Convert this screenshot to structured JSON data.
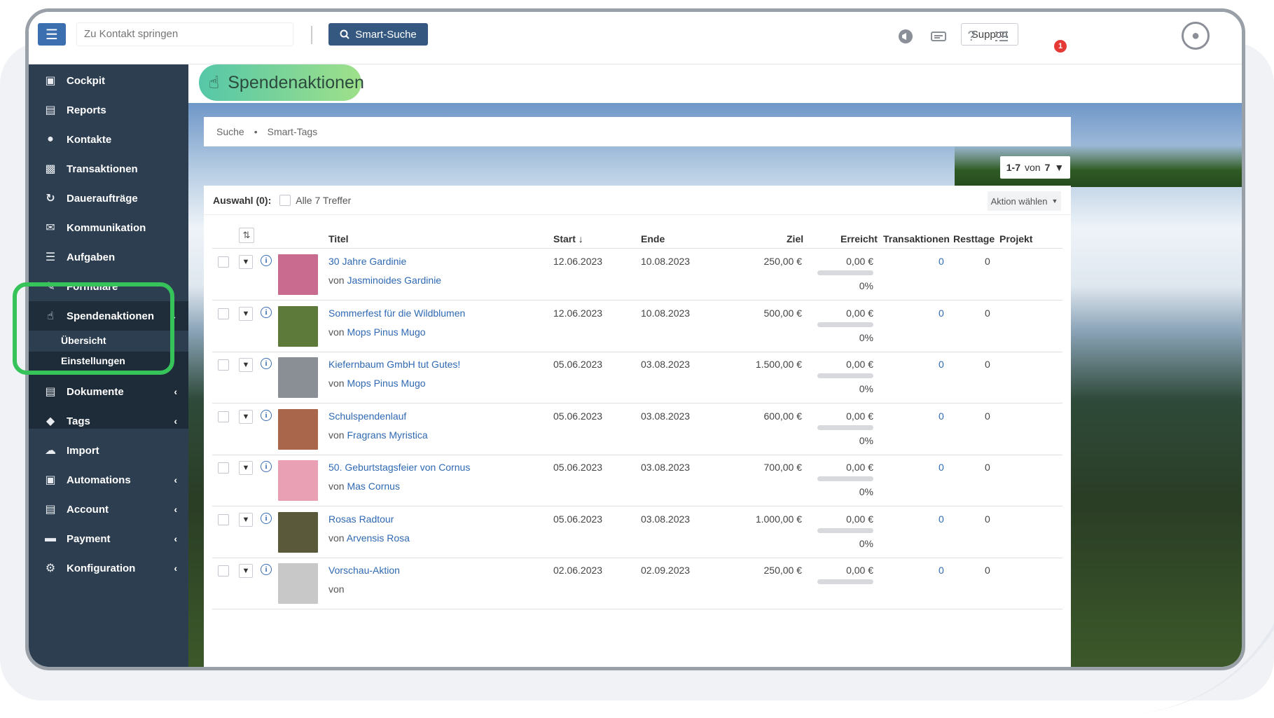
{
  "topbar": {
    "jump_placeholder": "Zu Kontakt springen",
    "smart_search_label": "Smart-Suche",
    "support_label": "Support",
    "notification_count": "1"
  },
  "sidebar": {
    "items": [
      {
        "label": "Cockpit",
        "icon": "laptop-icon"
      },
      {
        "label": "Reports",
        "icon": "chart-icon"
      },
      {
        "label": "Kontakte",
        "icon": "users-icon"
      },
      {
        "label": "Transaktionen",
        "icon": "money-icon"
      },
      {
        "label": "Daueraufträge",
        "icon": "recurring-icon"
      },
      {
        "label": "Kommunikation",
        "icon": "chat-icon"
      },
      {
        "label": "Aufgaben",
        "icon": "tasks-icon"
      },
      {
        "label": "Formulare",
        "icon": "form-icon"
      },
      {
        "label": "Spendenaktionen",
        "icon": "thumbs-up-icon"
      },
      {
        "label": "Dokumente",
        "icon": "document-icon"
      },
      {
        "label": "Tags",
        "icon": "tag-icon"
      },
      {
        "label": "Import",
        "icon": "cloud-upload-icon"
      },
      {
        "label": "Automations",
        "icon": "robot-icon"
      },
      {
        "label": "Account",
        "icon": "briefcase-icon"
      },
      {
        "label": "Payment",
        "icon": "credit-card-icon"
      },
      {
        "label": "Konfiguration",
        "icon": "gear-icon"
      }
    ],
    "sub_items": [
      "Übersicht",
      "Einstellungen"
    ]
  },
  "page": {
    "title": "Spendenaktionen",
    "tabs": [
      "Suche",
      "Smart-Tags"
    ],
    "pager_range": "1-7",
    "pager_of": "von",
    "pager_total": "7",
    "selection_label": "Auswahl (0):",
    "select_all_label": "Alle 7 Treffer",
    "action_label": "Aktion wählen"
  },
  "table": {
    "headers": {
      "titel": "Titel",
      "start": "Start",
      "ende": "Ende",
      "ziel": "Ziel",
      "erreicht": "Erreicht",
      "transaktionen": "Transaktionen",
      "resttage": "Resttage",
      "projekt": "Projekt"
    },
    "rows": [
      {
        "title": "30 Jahre Gardinie",
        "von": "von",
        "owner": "Jasminoides Gardinie",
        "start": "12.06.2023",
        "end": "10.08.2023",
        "ziel": "250,00 €",
        "erreicht": "0,00 €",
        "pct": "0%",
        "trans": "0",
        "rest": "0",
        "thumb_color": "#c96b8f"
      },
      {
        "title": "Sommerfest für die Wildblumen",
        "von": "von",
        "owner": "Mops Pinus Mugo",
        "start": "12.06.2023",
        "end": "10.08.2023",
        "ziel": "500,00 €",
        "erreicht": "0,00 €",
        "pct": "0%",
        "trans": "0",
        "rest": "0",
        "thumb_color": "#5e7a3a"
      },
      {
        "title": "Kiefernbaum GmbH tut Gutes!",
        "von": "von",
        "owner": "Mops Pinus Mugo",
        "start": "05.06.2023",
        "end": "03.08.2023",
        "ziel": "1.500,00 €",
        "erreicht": "0,00 €",
        "pct": "0%",
        "trans": "0",
        "rest": "0",
        "thumb_color": "#8a8f96"
      },
      {
        "title": "Schulspendenlauf",
        "von": "von",
        "owner": "Fragrans Myristica",
        "start": "05.06.2023",
        "end": "03.08.2023",
        "ziel": "600,00 €",
        "erreicht": "0,00 €",
        "pct": "0%",
        "trans": "0",
        "rest": "0",
        "thumb_color": "#a9664a"
      },
      {
        "title": "50. Geburtstagsfeier von Cornus",
        "von": "von",
        "owner": "Mas Cornus",
        "start": "05.06.2023",
        "end": "03.08.2023",
        "ziel": "700,00 €",
        "erreicht": "0,00 €",
        "pct": "0%",
        "trans": "0",
        "rest": "0",
        "thumb_color": "#e9a0b4"
      },
      {
        "title": "Rosas Radtour",
        "von": "von",
        "owner": "Arvensis Rosa",
        "start": "05.06.2023",
        "end": "03.08.2023",
        "ziel": "1.000,00 €",
        "erreicht": "0,00 €",
        "pct": "0%",
        "trans": "0",
        "rest": "0",
        "thumb_color": "#5a5a3a"
      },
      {
        "title": "Vorschau-Aktion",
        "von": "von",
        "owner": "",
        "start": "02.06.2023",
        "end": "02.09.2023",
        "ziel": "250,00 €",
        "erreicht": "0,00 €",
        "pct": "",
        "trans": "0",
        "rest": "0",
        "thumb_color": "#c8c8c8"
      }
    ]
  },
  "colors": {
    "sidebar_bg": "#2c3e50",
    "accent_blue": "#3b6fb0",
    "highlight_green": "#35c35a"
  }
}
